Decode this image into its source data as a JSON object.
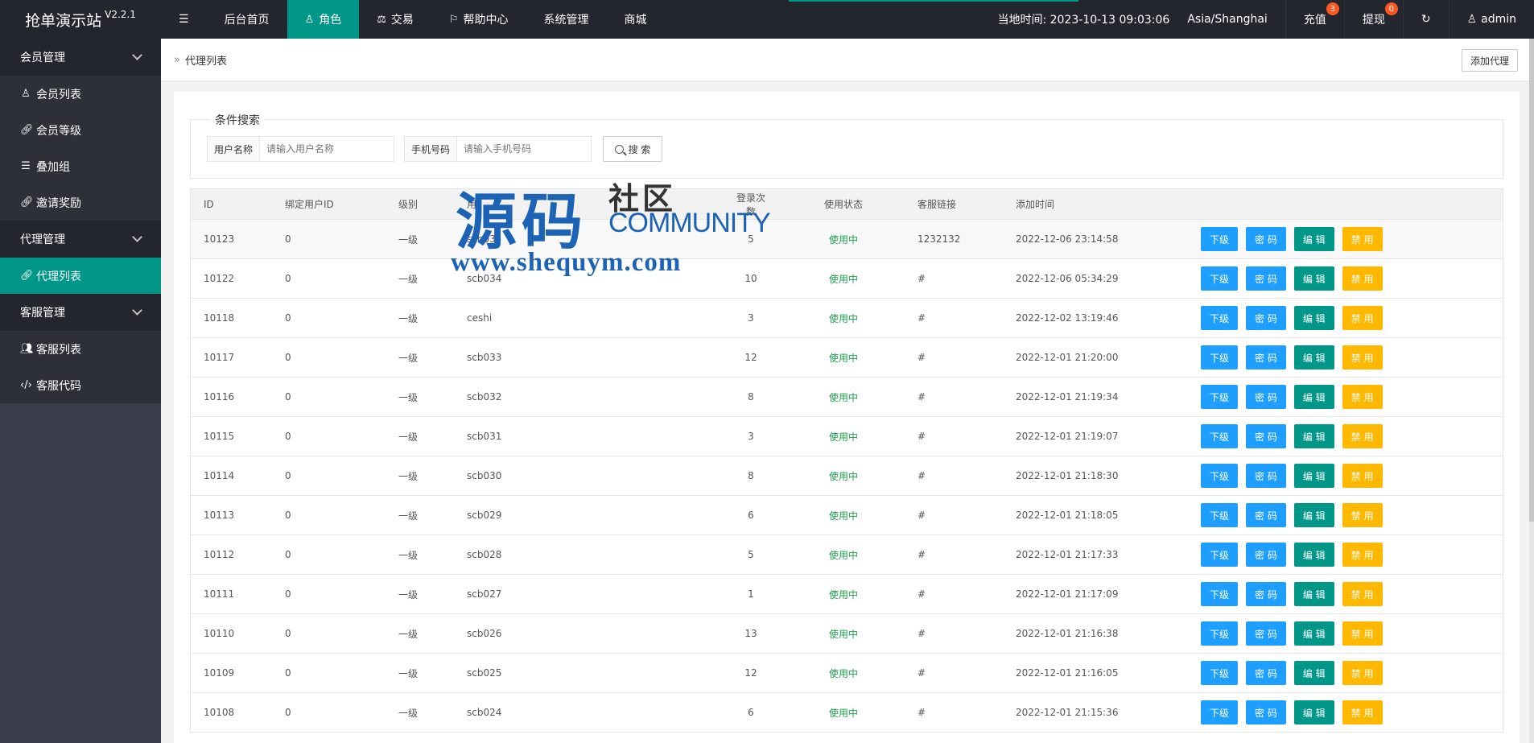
{
  "header": {
    "brand": "抢单演示站",
    "version": "V2.2.1",
    "nav": [
      {
        "label": "后台首页",
        "icon": ""
      },
      {
        "label": "角色",
        "icon": "user-icon",
        "active": true
      },
      {
        "label": "交易",
        "icon": "scale-icon"
      },
      {
        "label": "帮助中心",
        "icon": "flag-icon"
      },
      {
        "label": "系统管理",
        "icon": ""
      },
      {
        "label": "商城",
        "icon": ""
      }
    ],
    "time": "当地时间: 2023-10-13 09:03:06",
    "timezone": "Asia/Shanghai",
    "recharge": "充值",
    "recharge_badge": "3",
    "withdraw": "提现",
    "withdraw_badge": "0",
    "user": "admin"
  },
  "sidebar": {
    "groups": [
      {
        "label": "会员管理",
        "items": [
          {
            "label": "会员列表",
            "icon": "user-icon"
          },
          {
            "label": "会员等级",
            "icon": "link-icon"
          },
          {
            "label": "叠加组",
            "icon": "list-icon"
          },
          {
            "label": "邀请奖励",
            "icon": "link-icon"
          }
        ]
      },
      {
        "label": "代理管理",
        "items": [
          {
            "label": "代理列表",
            "icon": "link-icon",
            "active": true
          }
        ]
      },
      {
        "label": "客服管理",
        "items": [
          {
            "label": "客服列表",
            "icon": "users-icon"
          },
          {
            "label": "客服代码",
            "icon": "code-icon"
          }
        ]
      }
    ]
  },
  "main": {
    "breadcrumb": "代理列表",
    "add_button": "添加代理",
    "search": {
      "legend": "条件搜索",
      "username_label": "用户名称",
      "username_placeholder": "请输入用户名称",
      "phone_label": "手机号码",
      "phone_placeholder": "请输入手机号码",
      "button": "搜 索"
    },
    "table": {
      "headers": [
        "ID",
        "绑定用户ID",
        "级别",
        "用",
        "",
        "登录次数",
        "使用状态",
        "客服链接",
        "添加时间"
      ],
      "actions": [
        "下级",
        "密 码",
        "编 辑",
        "禁 用"
      ],
      "rows": [
        {
          "id": "10123",
          "bind": "0",
          "level": "一级",
          "user": "scb035",
          "count": "5",
          "status": "使用中",
          "link": "1232132",
          "time": "2022-12-06 23:14:58"
        },
        {
          "id": "10122",
          "bind": "0",
          "level": "一级",
          "user": "scb034",
          "count": "10",
          "status": "使用中",
          "link": "#",
          "time": "2022-12-06 05:34:29"
        },
        {
          "id": "10118",
          "bind": "0",
          "level": "一级",
          "user": "ceshi",
          "count": "3",
          "status": "使用中",
          "link": "#",
          "time": "2022-12-02 13:19:46"
        },
        {
          "id": "10117",
          "bind": "0",
          "level": "一级",
          "user": "scb033",
          "count": "12",
          "status": "使用中",
          "link": "#",
          "time": "2022-12-01 21:20:00"
        },
        {
          "id": "10116",
          "bind": "0",
          "level": "一级",
          "user": "scb032",
          "count": "8",
          "status": "使用中",
          "link": "#",
          "time": "2022-12-01 21:19:34"
        },
        {
          "id": "10115",
          "bind": "0",
          "level": "一级",
          "user": "scb031",
          "count": "3",
          "status": "使用中",
          "link": "#",
          "time": "2022-12-01 21:19:07"
        },
        {
          "id": "10114",
          "bind": "0",
          "level": "一级",
          "user": "scb030",
          "count": "8",
          "status": "使用中",
          "link": "#",
          "time": "2022-12-01 21:18:30"
        },
        {
          "id": "10113",
          "bind": "0",
          "level": "一级",
          "user": "scb029",
          "count": "6",
          "status": "使用中",
          "link": "#",
          "time": "2022-12-01 21:18:05"
        },
        {
          "id": "10112",
          "bind": "0",
          "level": "一级",
          "user": "scb028",
          "count": "5",
          "status": "使用中",
          "link": "#",
          "time": "2022-12-01 21:17:33"
        },
        {
          "id": "10111",
          "bind": "0",
          "level": "一级",
          "user": "scb027",
          "count": "1",
          "status": "使用中",
          "link": "#",
          "time": "2022-12-01 21:17:09"
        },
        {
          "id": "10110",
          "bind": "0",
          "level": "一级",
          "user": "scb026",
          "count": "13",
          "status": "使用中",
          "link": "#",
          "time": "2022-12-01 21:16:38"
        },
        {
          "id": "10109",
          "bind": "0",
          "level": "一级",
          "user": "scb025",
          "count": "12",
          "status": "使用中",
          "link": "#",
          "time": "2022-12-01 21:16:05"
        },
        {
          "id": "10108",
          "bind": "0",
          "level": "一级",
          "user": "scb024",
          "count": "6",
          "status": "使用中",
          "link": "#",
          "time": "2022-12-01 21:15:36"
        }
      ]
    }
  },
  "watermark": {
    "big": "源码",
    "cn": "社区",
    "en": "COMMUNITY",
    "url": "www.shequym.com"
  },
  "colors": {
    "accent": "#009688",
    "header_bg": "#23262e",
    "sidebar_bg": "#393d49",
    "btn_blue": "#1e9fff",
    "btn_orange": "#ffb800",
    "status_green": "#1aa34a"
  }
}
